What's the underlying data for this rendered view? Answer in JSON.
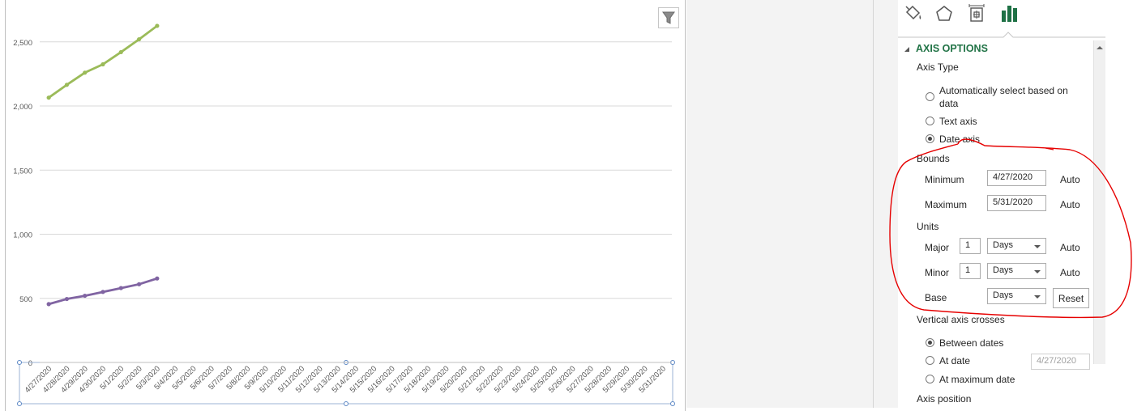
{
  "chart_data": {
    "type": "line",
    "x": [
      "4/27/2020",
      "4/28/2020",
      "4/29/2020",
      "4/30/2020",
      "5/1/2020",
      "5/2/2020",
      "5/3/2020",
      "5/4/2020",
      "5/5/2020",
      "5/6/2020",
      "5/7/2020",
      "5/8/2020",
      "5/9/2020",
      "5/10/2020",
      "5/11/2020",
      "5/12/2020",
      "5/13/2020",
      "5/14/2020",
      "5/15/2020",
      "5/16/2020",
      "5/17/2020",
      "5/18/2020",
      "5/19/2020",
      "5/20/2020",
      "5/21/2020",
      "5/22/2020",
      "5/23/2020",
      "5/24/2020",
      "5/25/2020",
      "5/26/2020",
      "5/27/2020",
      "5/28/2020",
      "5/29/2020",
      "5/30/2020",
      "5/31/2020"
    ],
    "series": [
      {
        "color": "#9bbb59",
        "values": [
          2065,
          2165,
          2260,
          2325,
          2420,
          2520,
          2625
        ]
      },
      {
        "color": "#8064a2",
        "values": [
          455,
          495,
          520,
          550,
          580,
          610,
          655
        ]
      }
    ],
    "yticks": [
      "0",
      "500",
      "1,000",
      "1,500",
      "2,000",
      "2,500"
    ],
    "ylim": [
      0,
      2700
    ],
    "grid": true
  },
  "pane": {
    "section_title": "AXIS OPTIONS",
    "axis_type_label": "Axis Type",
    "radio_auto": "Automatically select based on",
    "radio_auto_line2": "data",
    "radio_text": "Text axis",
    "radio_date": "Date axis",
    "bounds_label": "Bounds",
    "min_label": "Minimum",
    "min_value": "4/27/2020",
    "min_auto": "Auto",
    "max_label": "Maximum",
    "max_value": "5/31/2020",
    "max_auto": "Auto",
    "units_label": "Units",
    "major_label": "Major",
    "major_value": "1",
    "major_unit": "Days",
    "major_auto": "Auto",
    "minor_label": "Minor",
    "minor_value": "1",
    "minor_unit": "Days",
    "minor_auto": "Auto",
    "base_label": "Base",
    "base_unit": "Days",
    "reset_label": "Reset",
    "vertical_crosses_label": "Vertical axis crosses",
    "radio_between": "Between dates",
    "radio_at_date": "At date",
    "at_date_value": "4/27/2020",
    "radio_max_date": "At maximum date",
    "axis_position_label": "Axis position"
  },
  "colors": {
    "accent_green": "#217346",
    "annotation_red": "#e60000",
    "icon_green": "#1e7145"
  }
}
